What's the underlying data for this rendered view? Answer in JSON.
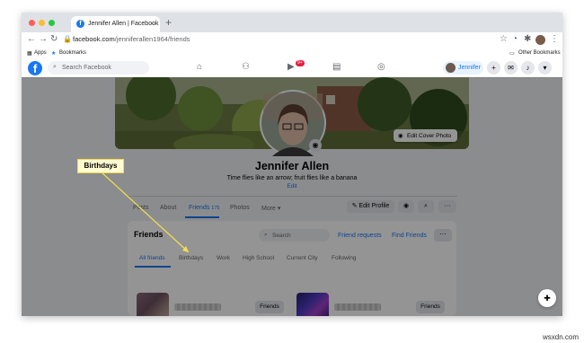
{
  "browser": {
    "tab_title": "Jennifer Allen | Facebook",
    "new_tab": "+",
    "tab_close": "×",
    "url_host": "facebook.com",
    "url_path": "/jenniferallen1964/friends",
    "bookmarks": {
      "apps": "Apps",
      "bookmarks": "Bookmarks",
      "other": "Other Bookmarks"
    }
  },
  "facebook": {
    "search_placeholder": "Search Facebook",
    "watch_badge": "9+",
    "user_name": "Jennifer"
  },
  "profile": {
    "edit_cover": "Edit Cover Photo",
    "name": "Jennifer Allen",
    "bio": "Time flies like an arrow; fruit flies like a banana",
    "edit_bio": "Edit",
    "tabs": {
      "posts": "Posts",
      "about": "About",
      "friends": "Friends",
      "friends_count": "175",
      "photos": "Photos",
      "more": "More ▾"
    },
    "buttons": {
      "edit_profile": "Edit Profile",
      "more": "···"
    }
  },
  "friends": {
    "title": "Friends",
    "search_placeholder": "Search",
    "friend_requests": "Friend requests",
    "find_friends": "Find Friends",
    "more": "···",
    "tabs": {
      "all": "All friends",
      "birthdays": "Birthdays",
      "work": "Work",
      "high_school": "High School",
      "current_city": "Current City",
      "following": "Following"
    },
    "friend_button": "Friends"
  },
  "annotation": {
    "label": "Birthdays"
  },
  "watermark": "wsxdn.com",
  "colors": {
    "facebook_blue": "#1877f2",
    "callout_fill": "#fffcd0",
    "callout_border": "#f7d94c",
    "arrow": "#f4e04d"
  }
}
